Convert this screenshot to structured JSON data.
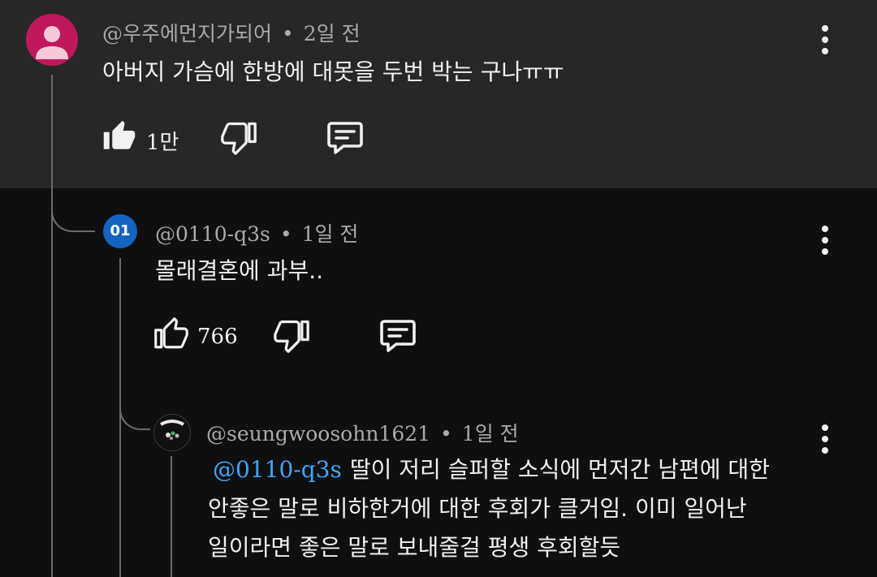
{
  "comments": [
    {
      "handle": "@우주에먼지가되어",
      "separator": "•",
      "time": "2일 전",
      "text": "아버지 가슴에 한방에 대못을 두번 박는 구나ㅠㅠ",
      "likes": "1만",
      "liked": true,
      "avatar_color": "#c0185c"
    },
    {
      "handle": "@0110-q3s",
      "separator": "•",
      "time": "1일 전",
      "avatar_label": "01",
      "text": "몰래결혼에 과부..",
      "likes": "766",
      "avatar_color": "#1565c0"
    },
    {
      "handle": "@seungwoosohn1621",
      "separator": "•",
      "time": "1일 전",
      "mention": "@0110-q3s",
      "line1": "딸이 저리 슬퍼할 소식에 먼저간 남편에 대한",
      "line2": "안좋은 말로 비하한거에 대한 후회가 클거임. 이미 일어난",
      "line3": "일이라면 좋은 말로 보내줄걸 평생 후회할듯"
    }
  ],
  "icons": {
    "like": "thumbs-up-icon",
    "dislike": "thumbs-down-icon",
    "reply": "comment-icon",
    "more": "more-vert-icon"
  },
  "colors": {
    "background": "#0f0f0f",
    "highlight": "#272727",
    "mention": "#3ea6ff",
    "meta": "#aaaaaa"
  }
}
